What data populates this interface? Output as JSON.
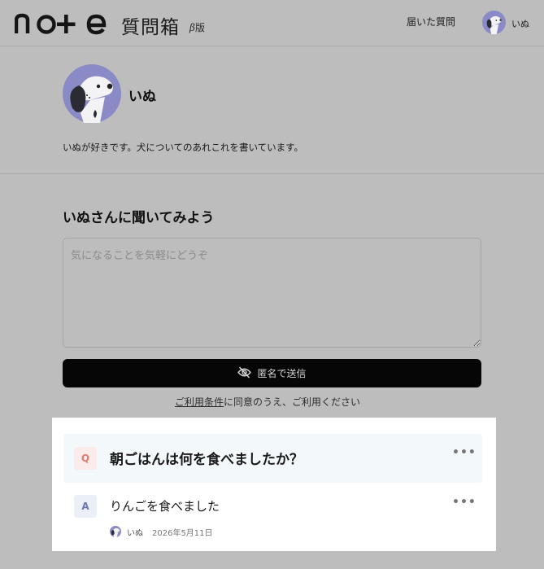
{
  "header": {
    "logo_text": "note",
    "site_name": "質問箱",
    "beta_symbol": "β",
    "beta_label": "版",
    "received_link": "届いた質問",
    "user_name": "いぬ"
  },
  "profile": {
    "name": "いぬ",
    "bio": "いぬが好きです。犬についてのあれこれを書いています。"
  },
  "ask_form": {
    "heading": "いぬさんに聞いてみよう",
    "placeholder": "気になることを気軽にどうぞ",
    "value": "",
    "send_label": "匿名で送信",
    "terms_link": "ご利用条件",
    "terms_rest": "に同意のうえ、ご利用ください"
  },
  "qa": {
    "question_badge": "Q",
    "question": "朝ごはんは何を食べましたか？",
    "answer_badge": "A",
    "answer": "りんごを食べました",
    "answerer": "いぬ",
    "date": "2026年5月11日",
    "more_symbol": "•••"
  },
  "colors": {
    "overlay_bg": "#bdbdbd",
    "button_bg": "#060606",
    "avatar_purple": "#8a8ac6",
    "q_badge_bg": "#fbeceb",
    "a_badge_bg": "#ebeff8"
  },
  "icons": {
    "logo": "note-logo",
    "avatar": "dog-avatar",
    "send": "eye-slash-icon",
    "more": "more-dots-icon"
  }
}
